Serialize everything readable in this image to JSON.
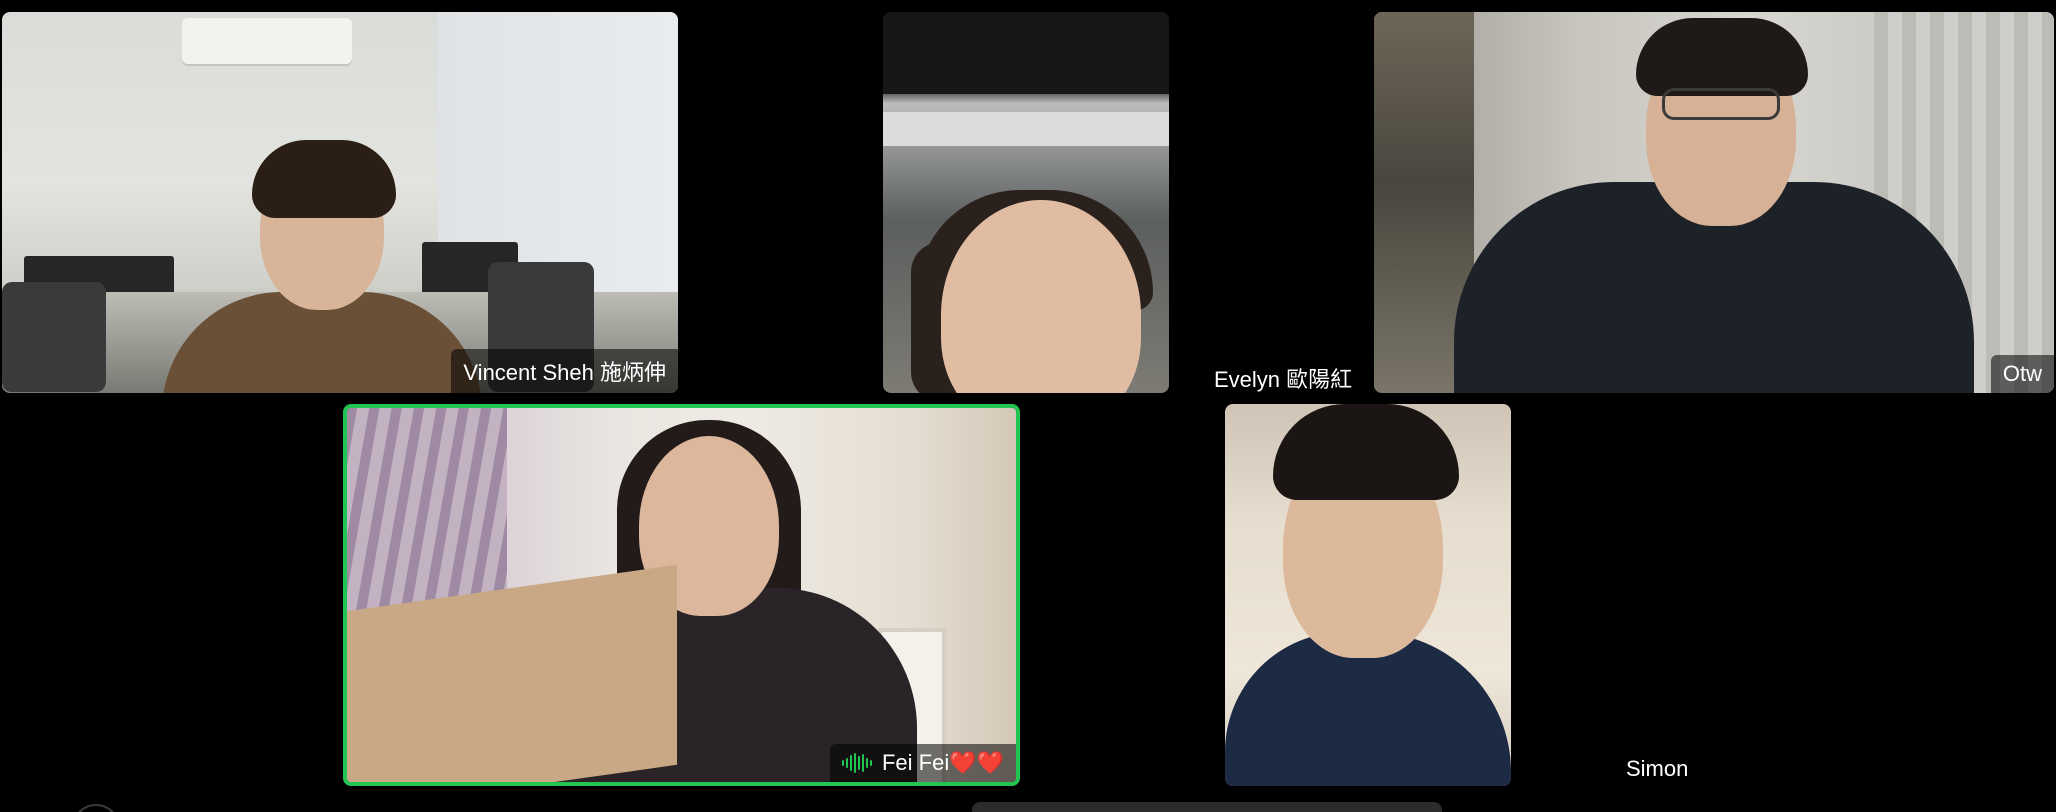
{
  "participants": [
    {
      "id": "vincent",
      "name": "Vincent Sheh 施炳伸"
    },
    {
      "id": "evelyn",
      "name": "Evelyn 歐陽紅"
    },
    {
      "id": "otw",
      "name": "Otw"
    },
    {
      "id": "feifei",
      "name": "Fei Fei❤️❤️",
      "active_speaker": true
    },
    {
      "id": "simon",
      "name": "Simon"
    }
  ],
  "colors": {
    "background": "#000000",
    "active_speaker_border": "#23c552",
    "name_label_text": "#ffffff"
  },
  "icons": {
    "active_speaker_indicator": "audio-bars-icon"
  }
}
